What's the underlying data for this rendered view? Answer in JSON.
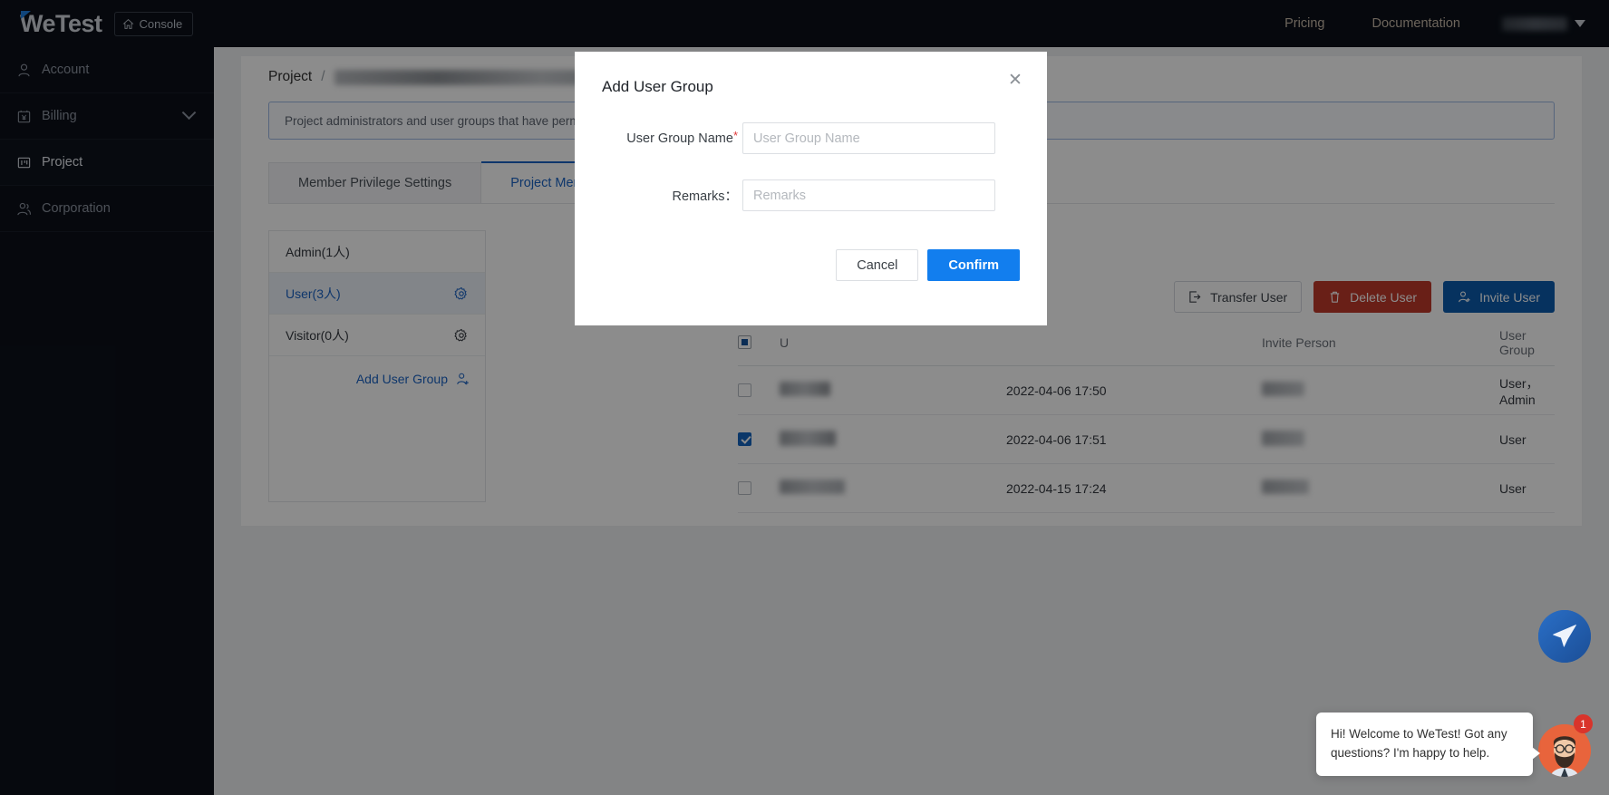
{
  "brand": {
    "logo_text": "WeTest",
    "console_label": "Console"
  },
  "topnav": {
    "links": [
      {
        "label": "Pricing"
      },
      {
        "label": "Documentation"
      }
    ]
  },
  "sidebar": {
    "items": [
      {
        "label": "Account",
        "icon": "user-icon",
        "active": false,
        "chevron": false
      },
      {
        "label": "Billing",
        "icon": "billing-icon",
        "active": false,
        "chevron": true
      },
      {
        "label": "Project",
        "icon": "project-icon",
        "active": true,
        "chevron": false
      },
      {
        "label": "Corporation",
        "icon": "corporation-icon",
        "active": false,
        "chevron": false
      }
    ]
  },
  "breadcrumb": {
    "root": "Project",
    "separator": "/",
    "current": ""
  },
  "notice": {
    "text": "Project administrators and user groups that have permiss"
  },
  "tabs": [
    {
      "label": "Member Privilege Settings",
      "active": false
    },
    {
      "label": "Project Member",
      "active": true
    }
  ],
  "group_panel": {
    "rows": [
      {
        "label": "Admin(1人)",
        "selected": false,
        "gear": false
      },
      {
        "label": "User(3人)",
        "selected": true,
        "gear": true
      },
      {
        "label": "Visitor(0人)",
        "selected": false,
        "gear": true
      }
    ],
    "add_label": "Add User Group"
  },
  "actions": [
    {
      "label": "Transfer User",
      "style": "ghost",
      "icon": "transfer-icon"
    },
    {
      "label": "Delete User",
      "style": "danger",
      "icon": "trash-icon"
    },
    {
      "label": "Invite User",
      "style": "primary",
      "icon": "invite-user-icon"
    }
  ],
  "table": {
    "headers": {
      "user": "U",
      "time": "",
      "invite_person": "Invite Person",
      "user_group": "User Group"
    },
    "header_checkbox": "indeterminate",
    "rows": [
      {
        "checked": false,
        "user": "",
        "time": "2022-04-06 17:50",
        "invite_person": "",
        "user_group": "User， Admin"
      },
      {
        "checked": true,
        "user": "",
        "time": "2022-04-06 17:51",
        "invite_person": "",
        "user_group": "User"
      },
      {
        "checked": false,
        "user": "",
        "time": "2022-04-15 17:24",
        "invite_person": "",
        "user_group": "User"
      }
    ]
  },
  "modal": {
    "title": "Add User Group",
    "close_icon": "✕",
    "fields": {
      "name_label": "User Group Name",
      "name_required": "*",
      "name_value": "",
      "name_placeholder": "User Group Name",
      "remarks_label": "Remarks：",
      "remarks_value": "",
      "remarks_placeholder": "Remarks"
    },
    "cancel_label": "Cancel",
    "confirm_label": "Confirm"
  },
  "chat": {
    "message": "Hi! Welcome to WeTest! Got any questions? I'm happy to help.",
    "badge_count": "1"
  },
  "colors": {
    "accent_blue": "#127eee",
    "link_blue": "#1b63c4",
    "danger_red": "#c0392b",
    "primary_blue": "#0b5cad",
    "sidebar_bg": "#0b1019"
  }
}
